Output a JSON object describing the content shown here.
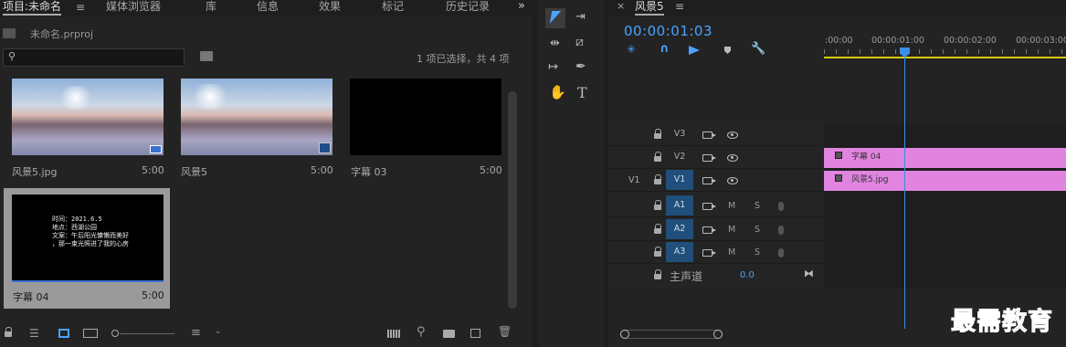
{
  "project_panel": {
    "tabs": [
      {
        "label": "项目:未命名"
      },
      {
        "label": "媒体浏览器"
      },
      {
        "label": "库"
      },
      {
        "label": "信息"
      },
      {
        "label": "效果"
      },
      {
        "label": "标记"
      },
      {
        "label": "历史记录"
      }
    ],
    "project_file": "未命名.prproj",
    "search_placeholder": "",
    "selection_status": "1 项已选择，共 4 项",
    "items": [
      {
        "name": "风景5.jpg",
        "duration": "5:00",
        "thumb": "scenery"
      },
      {
        "name": "风景5",
        "duration": "5:00",
        "thumb": "scenery"
      },
      {
        "name": "字幕 03",
        "duration": "5:00",
        "thumb": "black"
      },
      {
        "name": "字幕 04",
        "duration": "5:00",
        "thumb": "subtitle",
        "selected": true
      }
    ],
    "subtitle_lines": [
      "时间：2021.6.5",
      "地点：西湖公园",
      "文案：午后阳光慵懒而美好",
      "，那一束光照进了我的心房"
    ]
  },
  "timeline": {
    "sequence_name": "风景5",
    "timecode": "00:00:01:03",
    "ruler_labels": [
      ":00:00",
      "00:00:01:00",
      "00:00:02:00",
      "00:00:03:00"
    ],
    "video_tracks": [
      {
        "label": "V3",
        "source": ""
      },
      {
        "label": "V2",
        "source": ""
      },
      {
        "label": "V1",
        "source": "V1"
      }
    ],
    "audio_tracks": [
      {
        "label": "A1",
        "m": "M",
        "s": "S"
      },
      {
        "label": "A2",
        "m": "M",
        "s": "S"
      },
      {
        "label": "A3",
        "m": "M",
        "s": "S"
      }
    ],
    "master": {
      "label": "主声道",
      "value": "0.0"
    },
    "clips": [
      {
        "track": "V2",
        "name": "字幕 04"
      },
      {
        "track": "V1",
        "name": "风景5.jpg"
      }
    ]
  },
  "watermark": "最需教育",
  "colors": {
    "accent": "#4aa3ff",
    "clip": "#e184e0",
    "track_on": "#1f4f7a",
    "playhead": "#3a8fe6"
  }
}
